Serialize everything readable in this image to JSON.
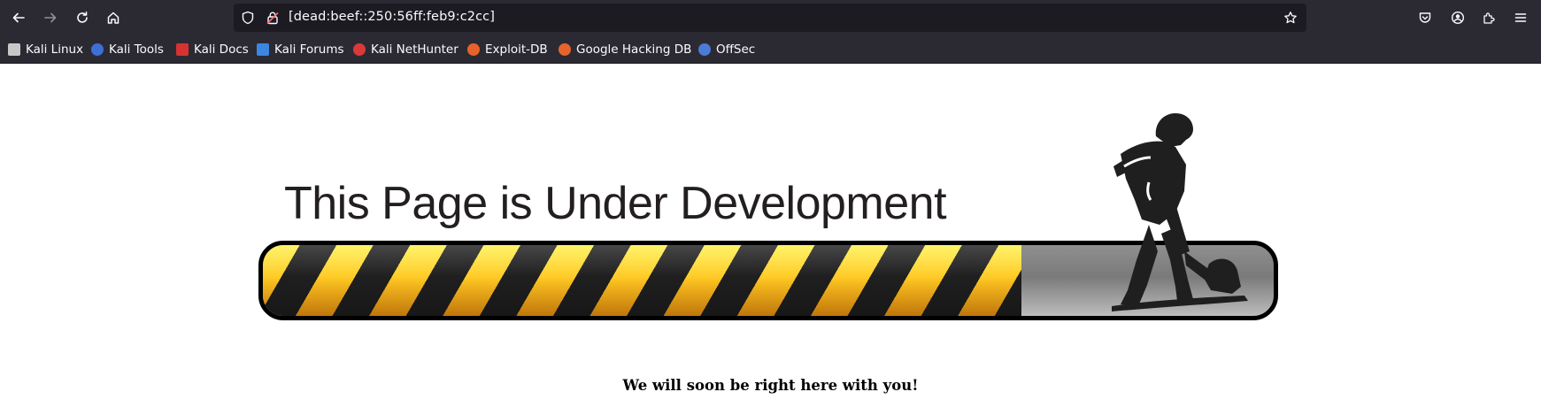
{
  "browser": {
    "url": "[dead:beef::250:56ff:feb9:c2cc]",
    "icons": {
      "back": "arrow-left-icon",
      "forward": "arrow-right-icon",
      "reload": "reload-icon",
      "home": "home-icon",
      "shield": "shield-icon",
      "lock": "insecure-lock-icon",
      "star": "star-icon",
      "pocket": "pocket-icon",
      "account": "account-icon",
      "extensions": "extensions-icon",
      "menu": "hamburger-menu-icon"
    }
  },
  "bookmarks": [
    {
      "label": "Kali Linux",
      "color": "#1f1f1f"
    },
    {
      "label": "Kali Tools",
      "color": "#3d6fd6"
    },
    {
      "label": "Kali Docs",
      "color": "#d63232"
    },
    {
      "label": "Kali Forums",
      "color": "#3a86e0"
    },
    {
      "label": "Kali NetHunter",
      "color": "#d83a3a"
    },
    {
      "label": "Exploit-DB",
      "color": "#e8632c"
    },
    {
      "label": "Google Hacking DB",
      "color": "#e8632c"
    },
    {
      "label": "OffSec",
      "color": "#4a7bd6"
    }
  ],
  "page": {
    "heading": "This Page is Under Development",
    "progress_fraction": 0.75,
    "message": "We will soon be right here with you!"
  }
}
